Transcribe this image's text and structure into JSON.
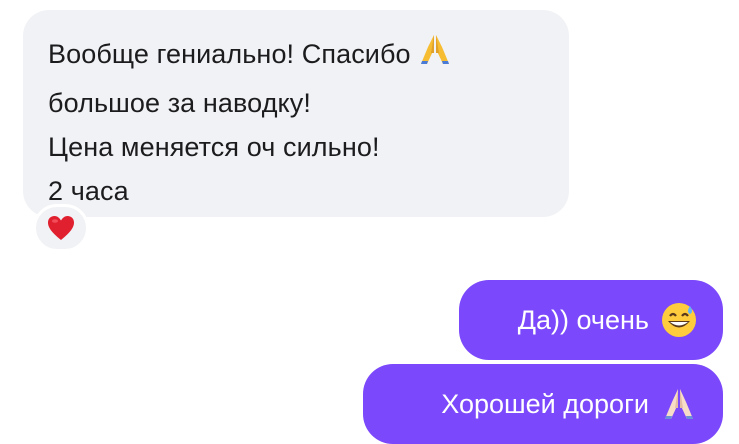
{
  "incoming_message": {
    "lines": [
      "Вообще гениально! Спасибо",
      "большое за наводку!",
      "Цена меняется оч сильно!",
      "2 часа"
    ],
    "line1_emoji": "🙏",
    "reaction_emoji": "❤️",
    "bubble_color": "#f1f2f5"
  },
  "outgoing_messages": [
    {
      "text": "Да)) очень",
      "emoji": "😅"
    },
    {
      "text": "Хорошей дороги",
      "emoji": "🙏🏻"
    }
  ],
  "colors": {
    "outgoing_bubble": "#7b48fb",
    "reaction_heart": "#e0202f"
  },
  "icons": {
    "reaction": "heart-icon",
    "msg1": "folded-hands-icon",
    "out1": "grinning-sweat-face-icon",
    "out2": "folded-hands-light-icon"
  }
}
